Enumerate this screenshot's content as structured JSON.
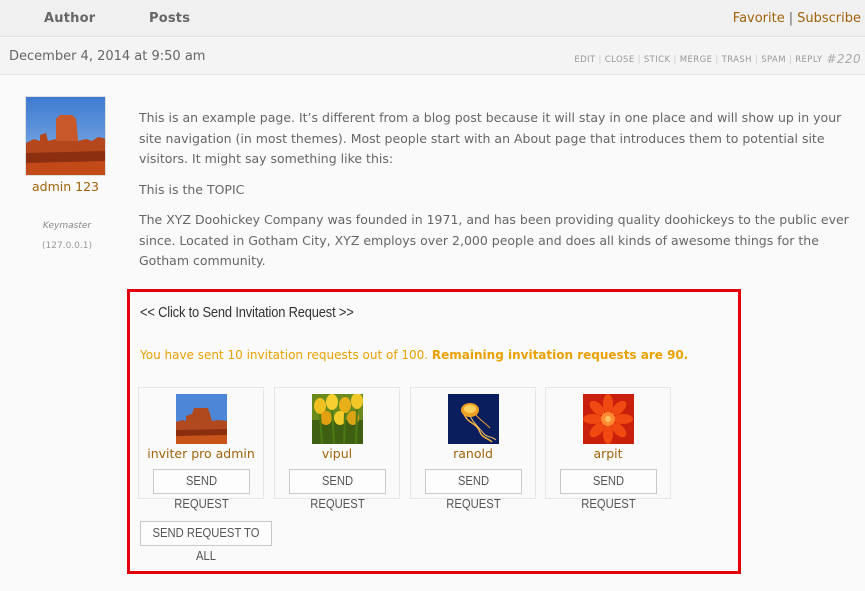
{
  "header": {
    "author_label": "Author",
    "posts_label": "Posts",
    "favorite_label": "Favorite",
    "separator": "|",
    "subscribe_label": "Subscribe"
  },
  "reply": {
    "date": "December 4, 2014 at 9:50 am",
    "admin_links": [
      "EDIT",
      "CLOSE",
      "STICK",
      "MERGE",
      "TRASH",
      "SPAM",
      "REPLY"
    ],
    "reply_number": "#220"
  },
  "author": {
    "name": "admin 123",
    "role": "Keymaster",
    "ip": "(127.0.0.1)",
    "avatar_icon": "desert-mesa-avatar"
  },
  "content": {
    "paragraphs": [
      "This is an example page. It’s different from a blog post because it will stay in one place and will show up in your site navigation (in most themes). Most people start with an About page that introduces them to potential site visitors. It might say something like this:",
      "This is the TOPIC",
      "The XYZ Doohickey Company was founded in 1971, and has been providing quality doohickeys to the public ever since. Located in Gotham City, XYZ employs over 2,000 people and does all kinds of awesome things for the Gotham community."
    ]
  },
  "invitation": {
    "title": "<< Click to Send Invitation Request >>",
    "status_prefix": "You have sent 10 invitation requests out of 100.",
    "status_bold": "Remaining invitation requests are 90.",
    "users": [
      {
        "name": "inviter pro admin",
        "button": "SEND REQUEST",
        "avatar_icon": "desert-mesa-avatar"
      },
      {
        "name": "vipul",
        "button": "SEND REQUEST",
        "avatar_icon": "tulips-avatar"
      },
      {
        "name": "ranold",
        "button": "SEND REQUEST",
        "avatar_icon": "jellyfish-avatar"
      },
      {
        "name": "arpit",
        "button": "SEND REQUEST",
        "avatar_icon": "red-flower-avatar"
      }
    ],
    "send_all_label": "SEND REQUEST TO ALL"
  },
  "colors": {
    "link": "#a0630a",
    "highlight_border": "#e3000b",
    "status": "#e8a100"
  }
}
